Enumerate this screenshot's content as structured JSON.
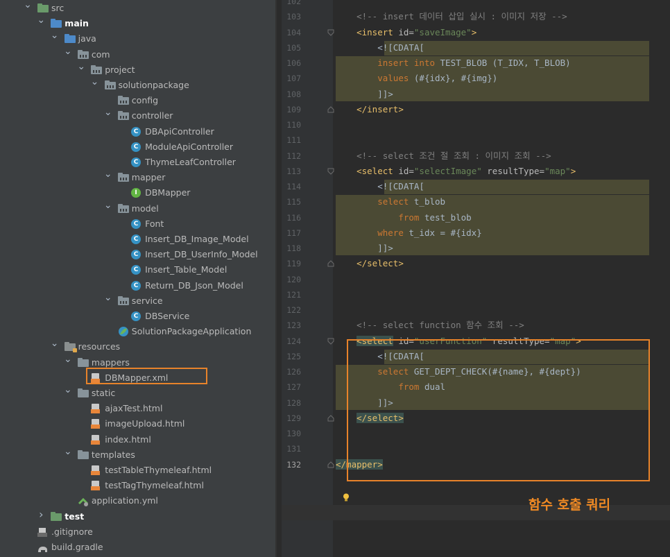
{
  "tree": [
    {
      "label": "src",
      "icon": "folder-icon",
      "arrow": "down",
      "indent": 0,
      "style": "grn",
      "name": "tree-item-src"
    },
    {
      "label": "main",
      "icon": "folder-icon",
      "arrow": "down",
      "indent": 1,
      "style": "blue",
      "bold": true,
      "name": "tree-item-main"
    },
    {
      "label": "java",
      "icon": "folder-icon",
      "arrow": "down",
      "indent": 2,
      "style": "blue",
      "name": "tree-item-java"
    },
    {
      "label": "com",
      "icon": "package-icon",
      "arrow": "down",
      "indent": 3,
      "style": "dots",
      "name": "tree-item-com"
    },
    {
      "label": "project",
      "icon": "package-icon",
      "arrow": "down",
      "indent": 4,
      "style": "dots",
      "name": "tree-item-project"
    },
    {
      "label": "solutionpackage",
      "icon": "package-icon",
      "arrow": "down",
      "indent": 5,
      "style": "dots",
      "name": "tree-item-solutionpackage"
    },
    {
      "label": "config",
      "icon": "package-icon",
      "arrow": "none",
      "indent": 6,
      "style": "dots",
      "name": "tree-item-config"
    },
    {
      "label": "controller",
      "icon": "package-icon",
      "arrow": "down",
      "indent": 6,
      "style": "dots",
      "name": "tree-item-controller"
    },
    {
      "label": "DBApiController",
      "icon": "class-icon",
      "arrow": "none",
      "indent": 7,
      "name": "tree-item-dbapicontroller"
    },
    {
      "label": "ModuleApiController",
      "icon": "class-icon",
      "arrow": "none",
      "indent": 7,
      "name": "tree-item-moduleapicontroller"
    },
    {
      "label": "ThymeLeafController",
      "icon": "class-icon",
      "arrow": "none",
      "indent": 7,
      "name": "tree-item-thymeleafcontroller"
    },
    {
      "label": "mapper",
      "icon": "package-icon",
      "arrow": "down",
      "indent": 6,
      "style": "dots",
      "name": "tree-item-mapper"
    },
    {
      "label": "DBMapper",
      "icon": "interface-icon",
      "arrow": "none",
      "indent": 7,
      "name": "tree-item-dbmapper"
    },
    {
      "label": "model",
      "icon": "package-icon",
      "arrow": "down",
      "indent": 6,
      "style": "dots",
      "name": "tree-item-model"
    },
    {
      "label": "Font",
      "icon": "class-icon",
      "arrow": "none",
      "indent": 7,
      "name": "tree-item-font"
    },
    {
      "label": "Insert_DB_Image_Model",
      "icon": "class-icon",
      "arrow": "none",
      "indent": 7,
      "name": "tree-item-insert-db-image-model"
    },
    {
      "label": "Insert_DB_UserInfo_Model",
      "icon": "class-icon",
      "arrow": "none",
      "indent": 7,
      "name": "tree-item-insert-db-userinfo-model"
    },
    {
      "label": "Insert_Table_Model",
      "icon": "class-icon",
      "arrow": "none",
      "indent": 7,
      "name": "tree-item-insert-table-model"
    },
    {
      "label": "Return_DB_Json_Model",
      "icon": "class-icon",
      "arrow": "none",
      "indent": 7,
      "name": "tree-item-return-db-json-model"
    },
    {
      "label": "service",
      "icon": "package-icon",
      "arrow": "down",
      "indent": 6,
      "style": "dots",
      "name": "tree-item-service"
    },
    {
      "label": "DBService",
      "icon": "class-icon",
      "arrow": "none",
      "indent": 7,
      "name": "tree-item-dbservice"
    },
    {
      "label": "SolutionPackageApplication",
      "icon": "spring-class-icon",
      "arrow": "none",
      "indent": 6,
      "name": "tree-item-solutionpackageapplication"
    },
    {
      "label": "resources",
      "icon": "folder-icon",
      "arrow": "down",
      "indent": 2,
      "style": "res",
      "name": "tree-item-resources"
    },
    {
      "label": "mappers",
      "icon": "folder-icon",
      "arrow": "down",
      "indent": 3,
      "name": "tree-item-mappers"
    },
    {
      "label": "DBMapper.xml",
      "icon": "xml-file-icon",
      "arrow": "none",
      "indent": 4,
      "name": "tree-item-dbmapper-xml",
      "selected": true
    },
    {
      "label": "static",
      "icon": "folder-icon",
      "arrow": "down",
      "indent": 3,
      "name": "tree-item-static"
    },
    {
      "label": "ajaxTest.html",
      "icon": "html-file-icon",
      "arrow": "none",
      "indent": 4,
      "name": "tree-item-ajaxtest-html"
    },
    {
      "label": "imageUpload.html",
      "icon": "html-file-icon",
      "arrow": "none",
      "indent": 4,
      "name": "tree-item-imageupload-html"
    },
    {
      "label": "index.html",
      "icon": "html-file-icon",
      "arrow": "none",
      "indent": 4,
      "name": "tree-item-index-html"
    },
    {
      "label": "templates",
      "icon": "folder-icon",
      "arrow": "down",
      "indent": 3,
      "name": "tree-item-templates"
    },
    {
      "label": "testTableThymeleaf.html",
      "icon": "html-file-icon",
      "arrow": "none",
      "indent": 4,
      "name": "tree-item-testtablethymeleaf-html"
    },
    {
      "label": "testTagThymeleaf.html",
      "icon": "html-file-icon",
      "arrow": "none",
      "indent": 4,
      "name": "tree-item-testtagthymeleaf-html"
    },
    {
      "label": "application.yml",
      "icon": "yml-file-icon",
      "arrow": "none",
      "indent": 3,
      "name": "tree-item-application-yml"
    },
    {
      "label": "test",
      "icon": "folder-icon",
      "arrow": "right",
      "indent": 1,
      "style": "grn",
      "bold": true,
      "name": "tree-item-test"
    },
    {
      "label": ".gitignore",
      "icon": "gitignore-icon",
      "arrow": "none",
      "indent": 0,
      "name": "tree-item-gitignore"
    },
    {
      "label": "build.gradle",
      "icon": "gradle-icon",
      "arrow": "none",
      "indent": 0,
      "name": "tree-item-build-gradle"
    }
  ],
  "line_numbers": [
    "102",
    "103",
    "104",
    "105",
    "106",
    "107",
    "108",
    "109",
    "110",
    "111",
    "112",
    "113",
    "114",
    "115",
    "116",
    "117",
    "118",
    "119",
    "120",
    "121",
    "122",
    "123",
    "124",
    "125",
    "126",
    "127",
    "128",
    "129",
    "130",
    "131",
    "132"
  ],
  "current_line": "132",
  "code_lines": [
    {
      "n": "102",
      "tokens": []
    },
    {
      "n": "103",
      "tokens": [
        {
          "t": "    <!-- insert 데이터 삽입 실시 : 이미지 저장 -->",
          "c": "cmt"
        }
      ]
    },
    {
      "n": "104",
      "tokens": [
        {
          "t": "    ",
          "c": "txt"
        },
        {
          "t": "<insert ",
          "c": "tag"
        },
        {
          "t": "id=",
          "c": "attr"
        },
        {
          "t": "\"saveImage\"",
          "c": "str"
        },
        {
          "t": ">",
          "c": "tag"
        }
      ]
    },
    {
      "n": "105",
      "tokens": [
        {
          "t": "        <![CDATA[",
          "c": "cd"
        }
      ]
    },
    {
      "n": "106",
      "tokens": [
        {
          "t": "        ",
          "c": "txt"
        },
        {
          "t": "insert into ",
          "c": "kw"
        },
        {
          "t": "TEST_BLOB (T_IDX, T_BLOB)",
          "c": "txt"
        }
      ]
    },
    {
      "n": "107",
      "tokens": [
        {
          "t": "        ",
          "c": "txt"
        },
        {
          "t": "values ",
          "c": "kw"
        },
        {
          "t": "(#{idx}, #{img})",
          "c": "txt"
        }
      ]
    },
    {
      "n": "108",
      "tokens": [
        {
          "t": "        ]]>",
          "c": "cd"
        }
      ]
    },
    {
      "n": "109",
      "tokens": [
        {
          "t": "    ",
          "c": "txt"
        },
        {
          "t": "</insert>",
          "c": "tag"
        }
      ]
    },
    {
      "n": "110",
      "tokens": []
    },
    {
      "n": "111",
      "tokens": []
    },
    {
      "n": "112",
      "tokens": [
        {
          "t": "    <!-- select 조건 절 조회 : 이미지 조회 -->",
          "c": "cmt"
        }
      ]
    },
    {
      "n": "113",
      "tokens": [
        {
          "t": "    ",
          "c": "txt"
        },
        {
          "t": "<select ",
          "c": "tag"
        },
        {
          "t": "id=",
          "c": "attr"
        },
        {
          "t": "\"selectImage\" ",
          "c": "str"
        },
        {
          "t": "resultType=",
          "c": "attr"
        },
        {
          "t": "\"map\"",
          "c": "str"
        },
        {
          "t": ">",
          "c": "tag"
        }
      ]
    },
    {
      "n": "114",
      "tokens": [
        {
          "t": "        <![CDATA[",
          "c": "cd"
        }
      ]
    },
    {
      "n": "115",
      "tokens": [
        {
          "t": "        ",
          "c": "txt"
        },
        {
          "t": "select ",
          "c": "kw"
        },
        {
          "t": "t_blob",
          "c": "txt"
        }
      ]
    },
    {
      "n": "116",
      "tokens": [
        {
          "t": "            ",
          "c": "txt"
        },
        {
          "t": "from ",
          "c": "kw"
        },
        {
          "t": "test_blob",
          "c": "txt"
        }
      ]
    },
    {
      "n": "117",
      "tokens": [
        {
          "t": "        ",
          "c": "txt"
        },
        {
          "t": "where ",
          "c": "kw"
        },
        {
          "t": "t_idx = #{idx}",
          "c": "txt"
        }
      ]
    },
    {
      "n": "118",
      "tokens": [
        {
          "t": "        ]]>",
          "c": "cd"
        }
      ]
    },
    {
      "n": "119",
      "tokens": [
        {
          "t": "    ",
          "c": "txt"
        },
        {
          "t": "</select>",
          "c": "tag"
        }
      ]
    },
    {
      "n": "120",
      "tokens": []
    },
    {
      "n": "121",
      "tokens": []
    },
    {
      "n": "122",
      "tokens": []
    },
    {
      "n": "123",
      "tokens": [
        {
          "t": "    <!-- select function 함수 조회 -->",
          "c": "cmt"
        }
      ]
    },
    {
      "n": "124",
      "tokens": [
        {
          "t": "    ",
          "c": "txt"
        },
        {
          "t": "<select",
          "c": "tag sel-tag"
        },
        {
          "t": " id=",
          "c": "attr"
        },
        {
          "t": "\"userFunction\" ",
          "c": "str"
        },
        {
          "t": "resultType=",
          "c": "attr"
        },
        {
          "t": "\"map\"",
          "c": "str"
        },
        {
          "t": ">",
          "c": "tag"
        }
      ]
    },
    {
      "n": "125",
      "tokens": [
        {
          "t": "        <![CDATA[",
          "c": "cd"
        }
      ]
    },
    {
      "n": "126",
      "tokens": [
        {
          "t": "        ",
          "c": "txt"
        },
        {
          "t": "select ",
          "c": "kw"
        },
        {
          "t": "GET_DEPT_CHECK(#{name}, #{dept})",
          "c": "txt"
        }
      ]
    },
    {
      "n": "127",
      "tokens": [
        {
          "t": "            ",
          "c": "txt"
        },
        {
          "t": "from ",
          "c": "kw"
        },
        {
          "t": "dual",
          "c": "txt"
        }
      ]
    },
    {
      "n": "128",
      "tokens": [
        {
          "t": "        ]]>",
          "c": "cd"
        }
      ]
    },
    {
      "n": "129",
      "tokens": [
        {
          "t": "    ",
          "c": "txt"
        },
        {
          "t": "</select>",
          "c": "tag sel-tag"
        }
      ]
    },
    {
      "n": "130",
      "tokens": []
    },
    {
      "n": "131",
      "tokens": []
    },
    {
      "n": "132",
      "tokens": [
        {
          "t": "</mapper>",
          "c": "tag sel-tag"
        }
      ]
    }
  ],
  "caption": "함수 호출 쿼리",
  "colors": {
    "accent": "#e8832a",
    "caption": "#f08a24",
    "sql_highlight": "#4b4a34"
  }
}
